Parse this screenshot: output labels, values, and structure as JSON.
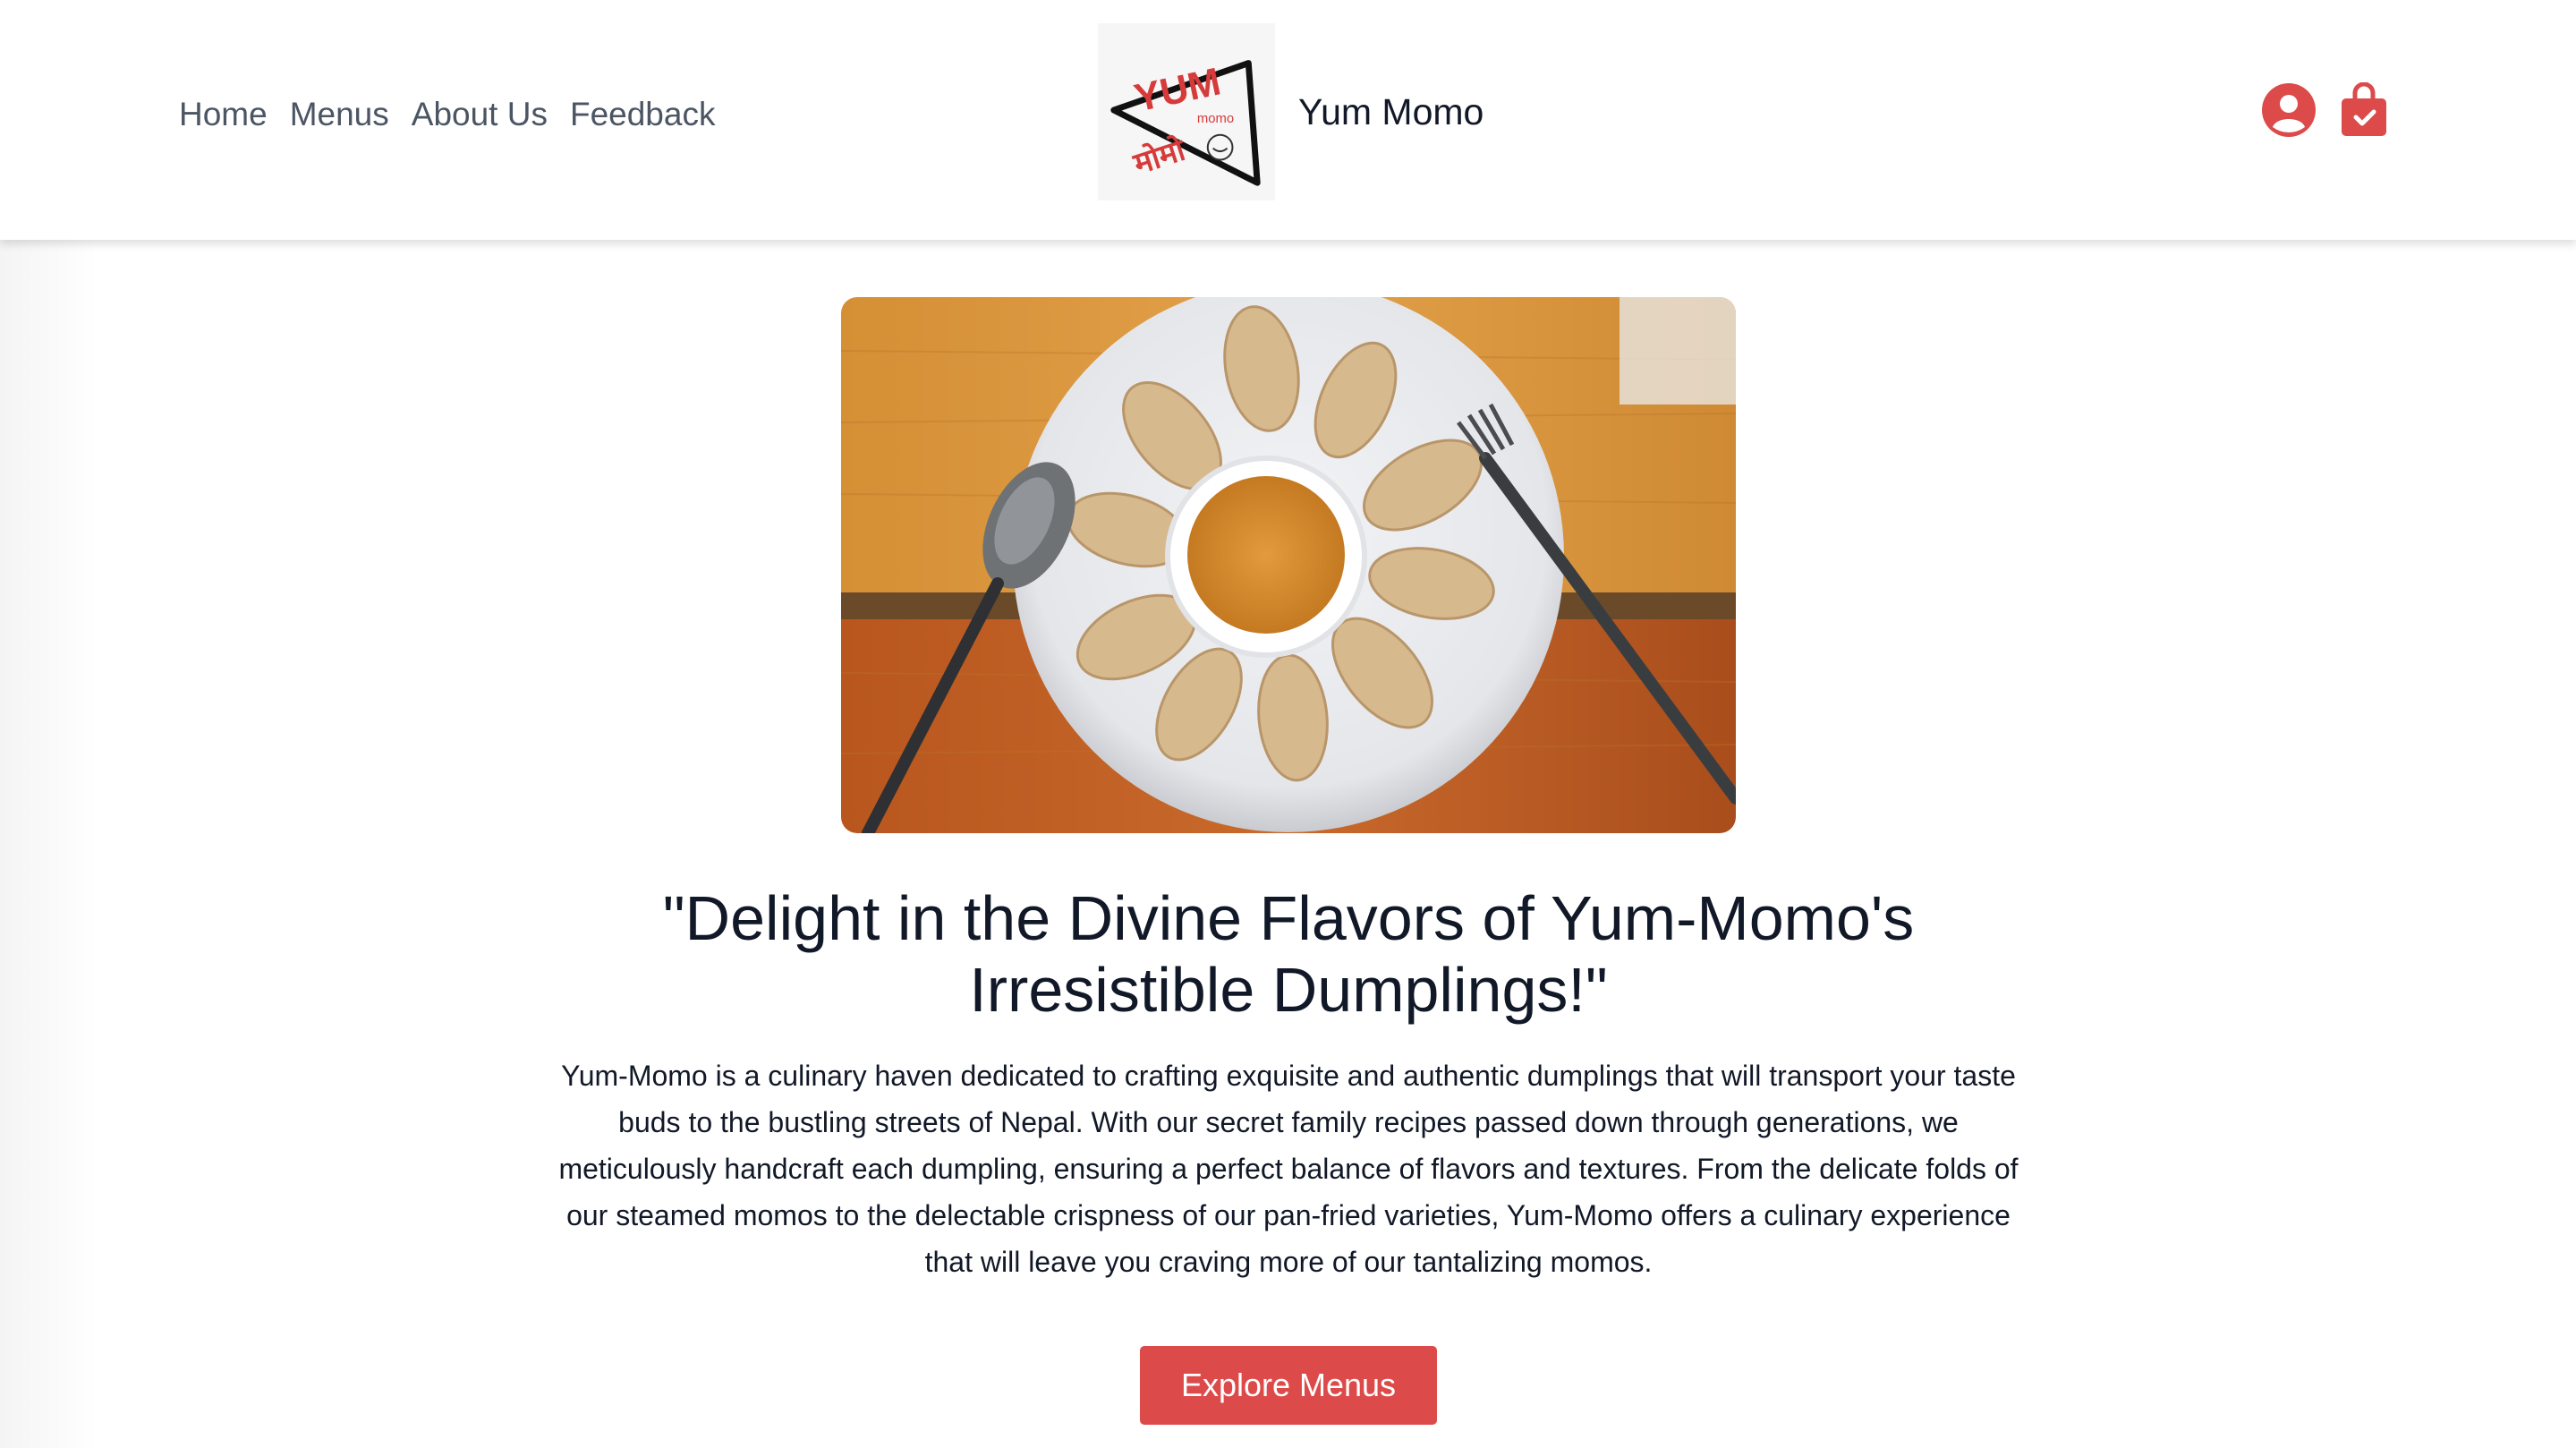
{
  "nav": {
    "items": [
      {
        "label": "Home"
      },
      {
        "label": "Menus"
      },
      {
        "label": "About Us"
      },
      {
        "label": "Feedback"
      }
    ]
  },
  "brand": {
    "name": "Yum Momo",
    "logo": {
      "text": "YUM",
      "subtext": "momo",
      "devanagari": "मोमो"
    }
  },
  "header_icons": [
    {
      "icon": "user-circle-icon"
    },
    {
      "icon": "shopping-bag-icon"
    }
  ],
  "hero": {
    "image": "momo-plate-photo",
    "heading": "\"Delight in the Divine Flavors of Yum-Momo's Irresistible Dumplings!\"",
    "description": "Yum-Momo is a culinary haven dedicated to crafting exquisite and authentic dumplings that will transport your taste buds to the bustling streets of Nepal. With our secret family recipes passed down through generations, we meticulously handcraft each dumpling, ensuring a perfect balance of flavors and textures. From the delicate folds of our steamed momos to the delectable crispness of our pan-fried varieties, Yum-Momo offers a culinary experience that will leave you craving more of our tantalizing momos.",
    "button": "Explore Menus"
  },
  "colors": {
    "accent": "#dc4a4a",
    "nav_text": "#4b5563",
    "heading": "#111827"
  }
}
